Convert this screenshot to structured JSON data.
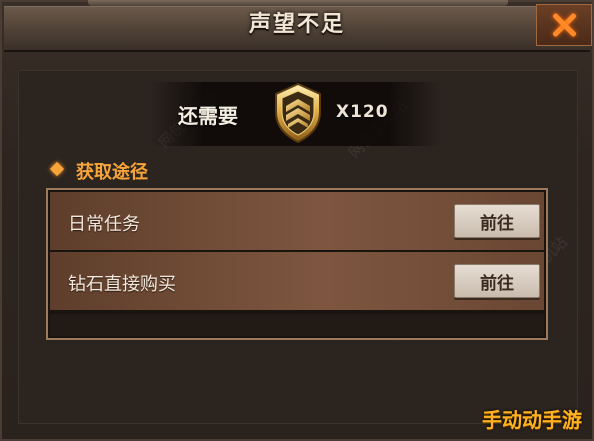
{
  "dialog": {
    "title": "声望不足",
    "close_icon": "close-x-icon"
  },
  "cost": {
    "label": "还需要",
    "icon": "prestige-rank-badge-icon",
    "amount": "X120"
  },
  "routes": {
    "title": "获取途径",
    "items": [
      {
        "label": "日常任务",
        "button": "前往"
      },
      {
        "label": "钻石直接购买",
        "button": "前往"
      }
    ]
  },
  "watermark": "网侠手机站",
  "corner_logo": "手动动手游",
  "colors": {
    "accent_orange": "#f7a43a",
    "close_orange": "#ff8a2a",
    "row_brown": "#7e5640",
    "badge_gold": "#d9a53c"
  }
}
